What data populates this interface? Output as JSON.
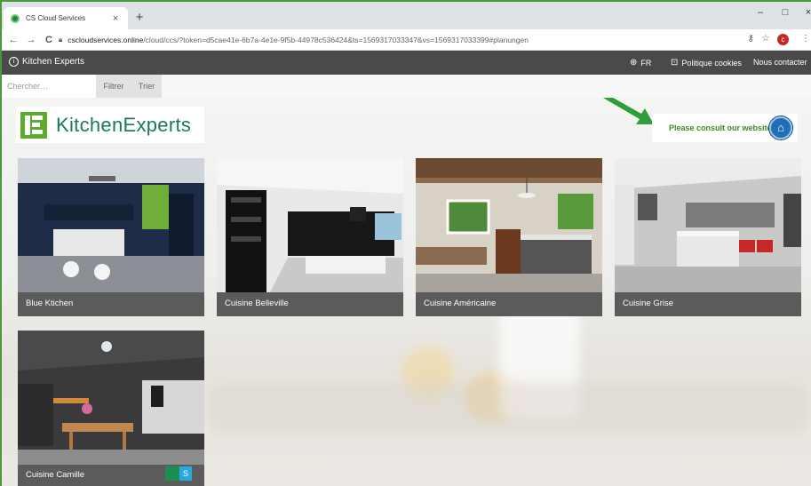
{
  "browser": {
    "tab_title": "CS Cloud Services",
    "tab_close": "×",
    "new_tab": "+",
    "url_host": "cscloudservices.online",
    "url_path": "/cloud/ccs/?token=d5cae41e-6b7a-4e1e-9f5b-44978c536424&ts=1569317033347&vs=1569317033399#planungen",
    "profile_initial": "c",
    "nav": {
      "back": "←",
      "forward": "→",
      "reload": "C"
    },
    "window_controls": {
      "minimize": "–",
      "maximize": "□",
      "close": "×"
    }
  },
  "header": {
    "brand": "Kitchen Experts",
    "brand_icon": "info-icon",
    "language": "FR",
    "cookies": "Politique cookies",
    "contact": "Nous contacter"
  },
  "toolbar": {
    "search_placeholder": "Chercher…",
    "filter": "Filtrer",
    "sort": "Trier"
  },
  "banner": {
    "logo_text": "KitchenExperts",
    "consult_text": "Please consult our website",
    "accent_color": "#3a8a1f",
    "header_color": "#4a4a4a"
  },
  "cards": [
    {
      "title": "Blue Ktichen"
    },
    {
      "title": "Cuisine Belleville"
    },
    {
      "title": "Cuisine Américaine"
    },
    {
      "title": "Cuisine Grise"
    },
    {
      "title": "Cuisine Camille",
      "badge_letter": "S"
    }
  ]
}
